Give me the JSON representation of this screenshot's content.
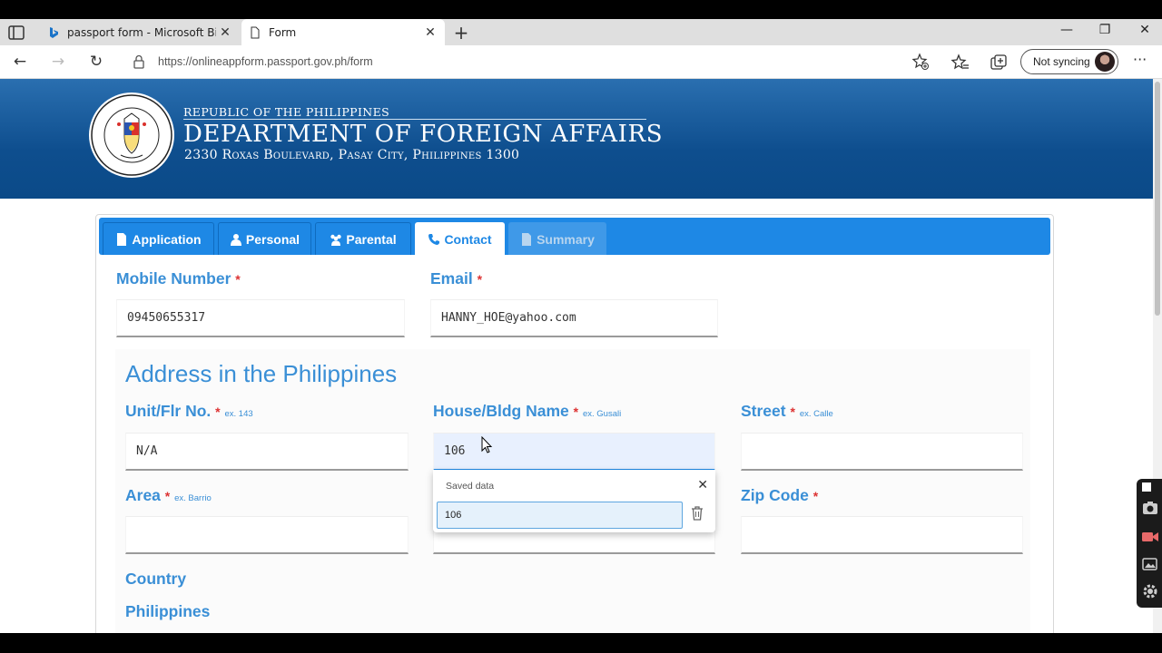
{
  "browser": {
    "tabs": [
      {
        "title": "passport form - Microsoft Bing S",
        "active": false
      },
      {
        "title": "Form",
        "active": true
      }
    ],
    "url": "https://onlineappform.passport.gov.ph/form",
    "sync_label": "Not syncing"
  },
  "header": {
    "line1": "Republic of the Philippines",
    "line2": "Department of Foreign Affairs",
    "line3": "2330 Roxas Boulevard, Pasay City, Philippines 1300"
  },
  "form_tabs": [
    {
      "label": "Application",
      "state": "normal"
    },
    {
      "label": "Personal",
      "state": "normal"
    },
    {
      "label": "Parental",
      "state": "normal"
    },
    {
      "label": "Contact",
      "state": "active"
    },
    {
      "label": "Summary",
      "state": "disabled"
    }
  ],
  "contact": {
    "mobile_label": "Mobile Number",
    "mobile_value": "09450655317",
    "email_label": "Email",
    "email_value": "HANNY_HOE@yahoo.com"
  },
  "address": {
    "title": "Address in the Philippines",
    "unit_label": "Unit/Flr No.",
    "unit_example": "ex. 143",
    "unit_value": "N/A",
    "house_label": "House/Bldg Name",
    "house_example": "ex. Gusali",
    "house_value": "106",
    "street_label": "Street",
    "street_example": "ex. Calle",
    "street_value": "",
    "area_label": "Area",
    "area_example": "ex. Barrio",
    "area_value": "",
    "zip_label": "Zip Code",
    "zip_value": "",
    "country_label": "Country",
    "country_value": "Philippines",
    "required_mark": "*"
  },
  "autofill": {
    "title": "Saved data",
    "item": "106"
  },
  "colors": {
    "header_blue": "#0e4e8e",
    "tab_blue": "#1e88e5",
    "label_blue": "#3a8fd6",
    "required_red": "#dd3333"
  }
}
